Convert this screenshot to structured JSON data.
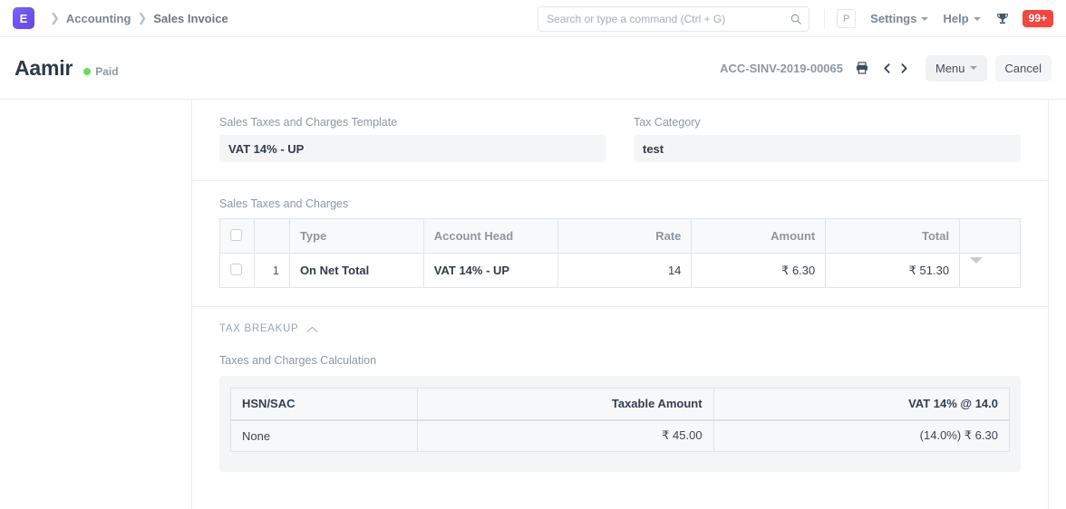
{
  "navbar": {
    "logo_letter": "E",
    "breadcrumbs": [
      {
        "label": "Accounting"
      },
      {
        "label": "Sales Invoice"
      }
    ],
    "search": {
      "placeholder": "Search or type a command (Ctrl + G)",
      "value": ""
    },
    "avatar_letter": "P",
    "settings_label": "Settings",
    "help_label": "Help",
    "notification_count": "99+"
  },
  "page_head": {
    "title": "Aamir",
    "status": "Paid",
    "status_color": "#65dd5c",
    "doc_id": "ACC-SINV-2019-00065",
    "menu_label": "Menu",
    "cancel_label": "Cancel"
  },
  "taxes_template_section": {
    "template_label": "Sales Taxes and Charges Template",
    "template_value": "VAT 14% - UP",
    "tax_category_label": "Tax Category",
    "tax_category_value": "test"
  },
  "charges_section": {
    "grid_label": "Sales Taxes and Charges",
    "columns": [
      {
        "key": "type",
        "label": "Type",
        "align": "left"
      },
      {
        "key": "account_head",
        "label": "Account Head",
        "align": "left"
      },
      {
        "key": "rate",
        "label": "Rate",
        "align": "right"
      },
      {
        "key": "amount",
        "label": "Amount",
        "align": "right"
      },
      {
        "key": "total",
        "label": "Total",
        "align": "right"
      }
    ],
    "rows": [
      {
        "idx": "1",
        "type": "On Net Total",
        "account_head": "VAT 14% - UP",
        "rate": "14",
        "amount": "₹ 6.30",
        "total": "₹ 51.30"
      }
    ]
  },
  "tax_breakup_section": {
    "section_title": "TAX BREAKUP",
    "calc_label": "Taxes and Charges Calculation",
    "columns": [
      {
        "key": "hsn",
        "label": "HSN/SAC",
        "align": "left"
      },
      {
        "key": "taxable",
        "label": "Taxable Amount",
        "align": "right"
      },
      {
        "key": "vat",
        "label": "VAT 14% @ 14.0",
        "align": "right"
      }
    ],
    "rows": [
      {
        "hsn": "None",
        "taxable": "₹ 45.00",
        "vat": "(14.0%) ₹ 6.30"
      }
    ]
  }
}
